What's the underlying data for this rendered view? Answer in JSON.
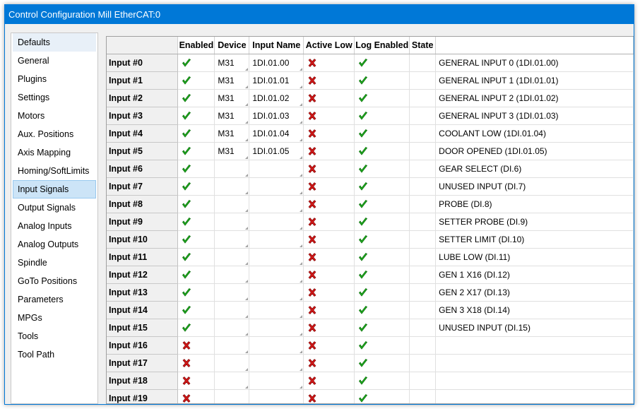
{
  "window": {
    "title": "Control Configuration Mill EtherCAT:0"
  },
  "sidebar": {
    "items": [
      {
        "label": "Defaults"
      },
      {
        "label": "General"
      },
      {
        "label": "Plugins"
      },
      {
        "label": "Settings"
      },
      {
        "label": "Motors"
      },
      {
        "label": "Aux. Positions"
      },
      {
        "label": "Axis Mapping"
      },
      {
        "label": "Homing/SoftLimits"
      },
      {
        "label": "Input Signals"
      },
      {
        "label": "Output Signals"
      },
      {
        "label": "Analog Inputs"
      },
      {
        "label": "Analog Outputs"
      },
      {
        "label": "Spindle"
      },
      {
        "label": "GoTo Positions"
      },
      {
        "label": "Parameters"
      },
      {
        "label": "MPGs"
      },
      {
        "label": "Tools"
      },
      {
        "label": "Tool Path"
      }
    ],
    "selected": "Input Signals"
  },
  "grid": {
    "columns": [
      "Enabled",
      "Device",
      "Input Name",
      "Active Low",
      "Log Enabled",
      "State"
    ],
    "rows": [
      {
        "label": "Input #0",
        "enabled": true,
        "device": "M31",
        "input_name": "1DI.01.00",
        "active_low": false,
        "log_enabled": true,
        "description": "GENERAL INPUT 0 (1DI.01.00)"
      },
      {
        "label": "Input #1",
        "enabled": true,
        "device": "M31",
        "input_name": "1DI.01.01",
        "active_low": false,
        "log_enabled": true,
        "description": "GENERAL INPUT 1 (1DI.01.01)"
      },
      {
        "label": "Input #2",
        "enabled": true,
        "device": "M31",
        "input_name": "1DI.01.02",
        "active_low": false,
        "log_enabled": true,
        "description": "GENERAL INPUT 2 (1DI.01.02)"
      },
      {
        "label": "Input #3",
        "enabled": true,
        "device": "M31",
        "input_name": "1DI.01.03",
        "active_low": false,
        "log_enabled": true,
        "description": "GENERAL INPUT 3 (1DI.01.03)"
      },
      {
        "label": "Input #4",
        "enabled": true,
        "device": "M31",
        "input_name": "1DI.01.04",
        "active_low": false,
        "log_enabled": true,
        "description": "COOLANT LOW (1DI.01.04)"
      },
      {
        "label": "Input #5",
        "enabled": true,
        "device": "M31",
        "input_name": "1DI.01.05",
        "active_low": false,
        "log_enabled": true,
        "description": "DOOR OPENED (1DI.01.05)"
      },
      {
        "label": "Input #6",
        "enabled": true,
        "device": "",
        "input_name": "",
        "active_low": false,
        "log_enabled": true,
        "description": "GEAR SELECT (DI.6)"
      },
      {
        "label": "Input #7",
        "enabled": true,
        "device": "",
        "input_name": "",
        "active_low": false,
        "log_enabled": true,
        "description": "UNUSED INPUT (DI.7)"
      },
      {
        "label": "Input #8",
        "enabled": true,
        "device": "",
        "input_name": "",
        "active_low": false,
        "log_enabled": true,
        "description": "PROBE (DI.8)"
      },
      {
        "label": "Input #9",
        "enabled": true,
        "device": "",
        "input_name": "",
        "active_low": false,
        "log_enabled": true,
        "description": "SETTER PROBE (DI.9)"
      },
      {
        "label": "Input #10",
        "enabled": true,
        "device": "",
        "input_name": "",
        "active_low": false,
        "log_enabled": true,
        "description": "SETTER LIMIT (DI.10)"
      },
      {
        "label": "Input #11",
        "enabled": true,
        "device": "",
        "input_name": "",
        "active_low": false,
        "log_enabled": true,
        "description": "LUBE LOW (DI.11)"
      },
      {
        "label": "Input #12",
        "enabled": true,
        "device": "",
        "input_name": "",
        "active_low": false,
        "log_enabled": true,
        "description": "GEN 1 X16 (DI.12)"
      },
      {
        "label": "Input #13",
        "enabled": true,
        "device": "",
        "input_name": "",
        "active_low": false,
        "log_enabled": true,
        "description": "GEN 2 X17 (DI.13)"
      },
      {
        "label": "Input #14",
        "enabled": true,
        "device": "",
        "input_name": "",
        "active_low": false,
        "log_enabled": true,
        "description": "GEN 3 X18 (DI.14)"
      },
      {
        "label": "Input #15",
        "enabled": true,
        "device": "",
        "input_name": "",
        "active_low": false,
        "log_enabled": true,
        "description": "UNUSED INPUT (DI.15)"
      },
      {
        "label": "Input #16",
        "enabled": false,
        "device": "",
        "input_name": "",
        "active_low": false,
        "log_enabled": true,
        "description": ""
      },
      {
        "label": "Input #17",
        "enabled": false,
        "device": "",
        "input_name": "",
        "active_low": false,
        "log_enabled": true,
        "description": ""
      },
      {
        "label": "Input #18",
        "enabled": false,
        "device": "",
        "input_name": "",
        "active_low": false,
        "log_enabled": true,
        "description": ""
      },
      {
        "label": "Input #19",
        "enabled": false,
        "device": "",
        "input_name": "",
        "active_low": false,
        "log_enabled": true,
        "description": ""
      }
    ]
  },
  "colors": {
    "titlebar": "#0078d7",
    "check": "#22b422",
    "cross": "#d01818",
    "selection": "#cce4f7"
  },
  "icons": {
    "true": "check-icon",
    "false": "cross-icon"
  }
}
